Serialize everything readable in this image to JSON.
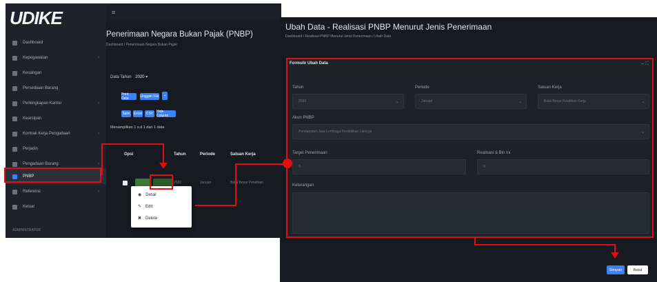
{
  "left": {
    "logo": "UDIKE",
    "logo_sub": "",
    "sidebar": [
      {
        "label": "Dashboard",
        "chev": ""
      },
      {
        "label": "Kepegawaian",
        "chev": "›"
      },
      {
        "label": "Keuangan",
        "chev": ""
      },
      {
        "label": "Persediaan Barang",
        "chev": ""
      },
      {
        "label": "Perlengkapan Kantor",
        "chev": "›"
      },
      {
        "label": "Kearsipan",
        "chev": ""
      },
      {
        "label": "Kontrak Kerja Pengadaan",
        "chev": "›"
      },
      {
        "label": "Perjadin",
        "chev": ""
      },
      {
        "label": "Pengadaan Barang",
        "chev": "›"
      },
      {
        "label": "PNBP",
        "chev": ""
      },
      {
        "label": "Referensi",
        "chev": "›"
      },
      {
        "label": "Keluar",
        "chev": ""
      }
    ],
    "sidebar_footer": "ADMINISTRATOR",
    "page_title": "Penerimaan Negara Bukan Pajak (PNBP)",
    "breadcrumb": "Dashboard / Penerimaan Negara Bukan Pajak",
    "filter": {
      "label": "Data Tahun",
      "value": "2020"
    },
    "buttons_row1": [
      "Print Data",
      "Unggah File"
    ],
    "buttons_row2": [
      "Salin",
      "Excel",
      "CSV",
      "Hide Column"
    ],
    "show_label": "Menampilkan 1 s.d 1 dari 1 data",
    "table_headers": [
      "Opsi",
      "Tahun",
      "Periode",
      "Satuan Kerja"
    ],
    "row": {
      "tahun": "2020",
      "periode": "Januari",
      "satker": "Balai Besar Pelatihan"
    },
    "context_menu": [
      {
        "icon": "eye-icon",
        "glyph": "◉",
        "label": "Detail"
      },
      {
        "icon": "pencil-icon",
        "glyph": "✎",
        "label": "Edit"
      },
      {
        "icon": "trash-icon",
        "glyph": "✖",
        "label": "Delete"
      }
    ]
  },
  "right": {
    "title": "Ubah Data - Realisasi PNBP Menurut Jenis Penerimaan",
    "breadcrumb": "Dashboard / Realisasi PNBP Menurut Jenis Penerimaan / Ubah Data",
    "form_title": "Formulir Ubah Data",
    "form_controls": "– ⛶",
    "fields": {
      "tahun": {
        "label": "Tahun",
        "value": "2020"
      },
      "periode": {
        "label": "Periode",
        "value": "Januari"
      },
      "satker": {
        "label": "Satuan Kerja",
        "value": "Balai Besar Pelatihan Kerja"
      },
      "akun": {
        "label": "Akun PNBP",
        "value": "Pendapatan Jasa Lembaga Pendidikan Lainnya"
      },
      "target": {
        "label": "Target Penerimaan",
        "value": "0"
      },
      "realisasi": {
        "label": "Realisasi & Bln Ini",
        "value": "0"
      },
      "keterangan": {
        "label": "Keterangan",
        "value": ""
      }
    },
    "save": "Simpan",
    "cancel": "Batal"
  },
  "colors": {
    "accent": "#3b82f6",
    "highlight": "#e01010",
    "bg": "#171a21"
  }
}
